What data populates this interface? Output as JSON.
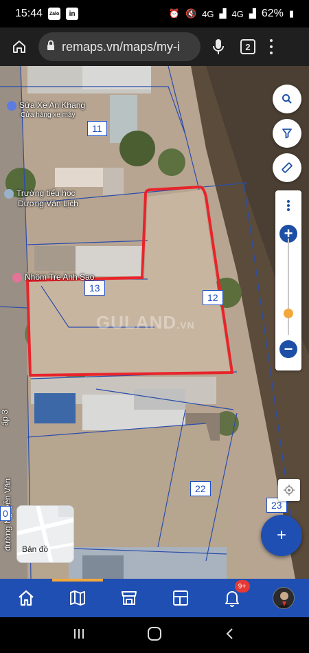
{
  "status_bar": {
    "time": "15:44",
    "apps": [
      "Zalo",
      "in"
    ],
    "signal1": "4G",
    "signal2": "4G",
    "battery": "62%"
  },
  "browser": {
    "url": "remaps.vn/maps/my-i",
    "tab_count": "2"
  },
  "map": {
    "pois": [
      {
        "name": "Sửa Xe An Khang",
        "sub": "Cửa hàng xe máy"
      },
      {
        "name": "Trường tiểu học",
        "sub": "Dương Văn Lịch"
      },
      {
        "name": "Nhôm Tre Anh Sao",
        "sub": ""
      }
    ],
    "lots": {
      "lot11": "11",
      "lot13": "13",
      "lot12": "12",
      "lot22": "22",
      "lot23": "23"
    },
    "road_labels": {
      "ap3": "ấp 3",
      "road": "đường Nguyễn Văn",
      "edge0": "0"
    },
    "watermark": {
      "main": "GULAND",
      "suffix": ".VN"
    },
    "mini_map_label": "Bản đồ",
    "fab_add": "+",
    "zoom_in": "+",
    "zoom_out": "−",
    "colors": {
      "highlight": "#e8242a",
      "lot_lines": "#2a4dab",
      "brand": "#1f4fb3",
      "accent": "#f2a93b"
    }
  },
  "bottom_nav": {
    "items": [
      "home-icon",
      "map-icon",
      "store-icon",
      "dashboard-icon",
      "bell-icon",
      "avatar"
    ],
    "notification_badge": "9+"
  }
}
